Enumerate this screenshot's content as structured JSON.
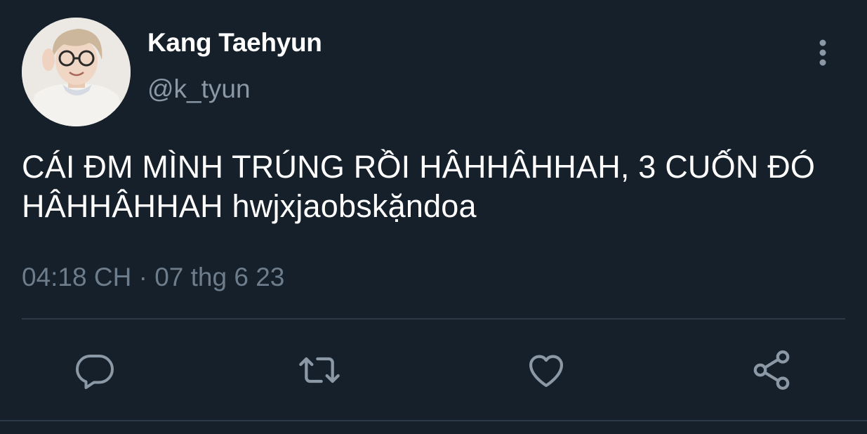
{
  "tweet": {
    "author": {
      "display_name": "Kang Taehyun",
      "handle": "@k_tyun",
      "avatar": "profile-photo"
    },
    "text": "CÁI ĐM MÌNH TRÚNG RỒI HÂHHÂHHAH, 3 CUỐN ĐÓ HÂHHÂHHAH hwjxjaobskặndoa",
    "timestamp": "04:18 CH · 07 thg 6 23"
  },
  "actions": [
    {
      "icon": "reply-icon"
    },
    {
      "icon": "retweet-icon"
    },
    {
      "icon": "like-icon"
    },
    {
      "icon": "share-icon"
    }
  ],
  "menu": {
    "icon": "more-vertical-icon"
  },
  "colors": {
    "background": "#15202b",
    "primary_text": "#ffffff",
    "secondary_text": "#8b98a5",
    "icon": "#8b98a5",
    "divider": "#2c3a47"
  }
}
